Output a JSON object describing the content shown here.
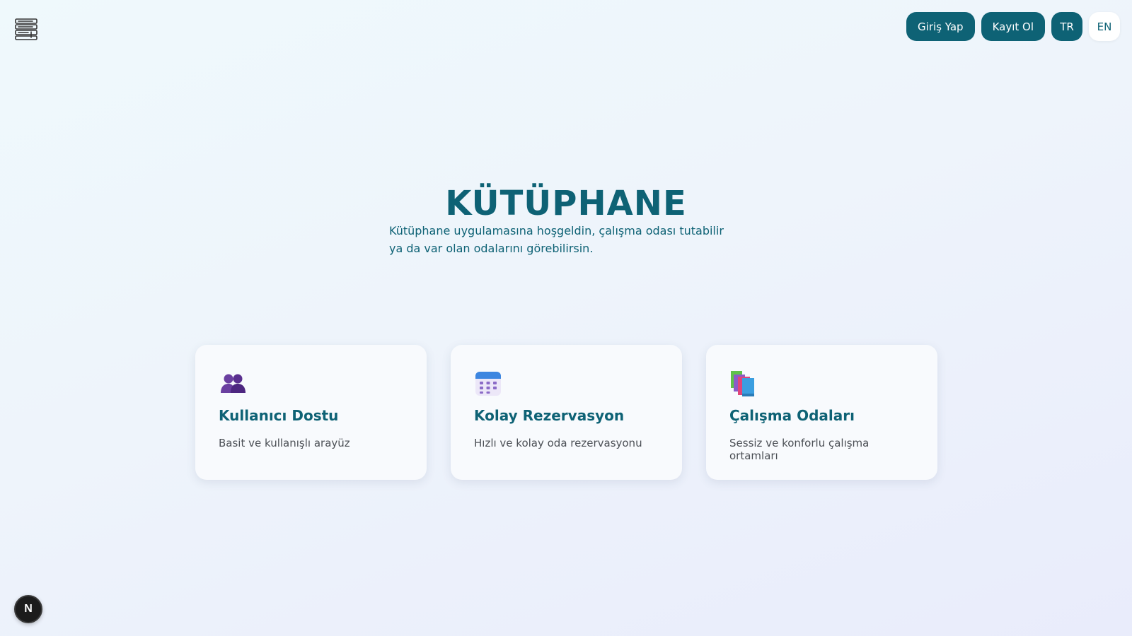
{
  "header": {
    "login_label": "Giriş Yap",
    "register_label": "Kayıt Ol",
    "lang_tr": "TR",
    "lang_en": "EN",
    "active_lang": "TR"
  },
  "hero": {
    "title": "KÜTÜPHANE",
    "description": "Kütüphane uygulamasına hoşgeldin, çalışma odası tutabilir ya da var olan odalarını görebilirsin."
  },
  "features": [
    {
      "icon": "users-icon",
      "title": "Kullanıcı Dostu",
      "description": "Basit ve kullanışlı arayüz"
    },
    {
      "icon": "calendar-icon",
      "title": "Kolay Rezervasyon",
      "description": "Hızlı ve kolay oda rezervasyonu"
    },
    {
      "icon": "books-icon",
      "title": "Çalışma Odaları",
      "description": "Sessiz ve konforlu çalışma ortamları"
    }
  ],
  "badge": {
    "label": "N"
  },
  "colors": {
    "primary": "#0e6275",
    "card_bg": "#f8fafd",
    "text_muted": "#4b4f55"
  }
}
